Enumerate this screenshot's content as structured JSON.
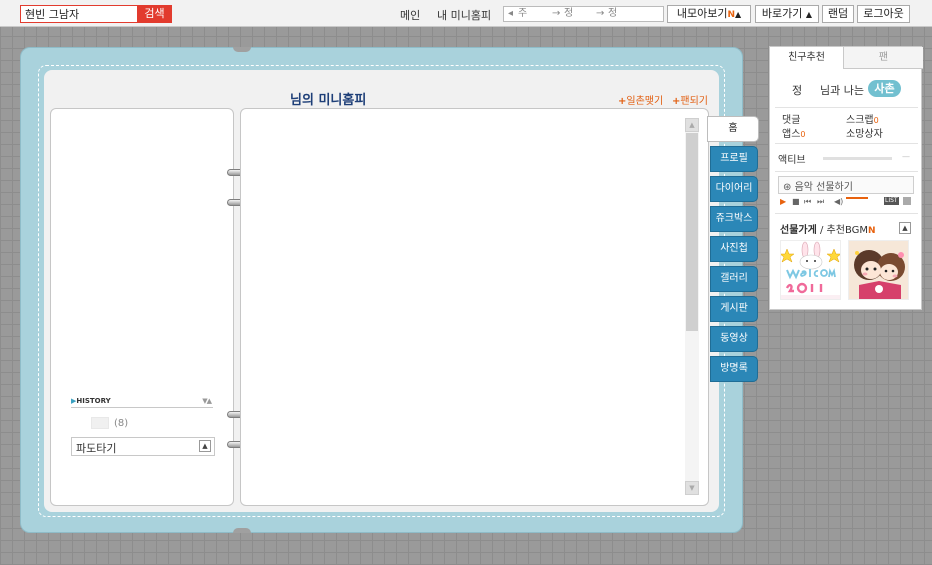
{
  "topbar": {
    "search_value": "현빈 그남자",
    "search_button": "검색",
    "link_main": "메인",
    "link_my_home": "내 미니홈피",
    "nav_select": {
      "seg1": "주",
      "seg2": "정",
      "seg3": "정"
    },
    "my_view": "내모아보기",
    "new_badge": "N",
    "shortcut": "바로가기",
    "random": "랜덤",
    "logout": "로그아웃"
  },
  "home": {
    "title": "님의 미니홈피",
    "link_ilchon": "일촌맺기",
    "link_fan": "팬되기"
  },
  "left": {
    "history_label": "HISTORY",
    "history_count": "(8)",
    "pado_label": "파도타기"
  },
  "tabs": [
    {
      "label": "홈"
    },
    {
      "label": "프로필"
    },
    {
      "label": "다이어리"
    },
    {
      "label": "쥬크박스"
    },
    {
      "label": "사진첩"
    },
    {
      "label": "갤러리"
    },
    {
      "label": "게시판"
    },
    {
      "label": "동영상"
    },
    {
      "label": "방명록"
    }
  ],
  "widget": {
    "tab_friend": "친구추천",
    "tab_fan": "팬",
    "relation_left": "정",
    "relation_mid": "님과 나는",
    "relation_badge": "사촌",
    "stat_comment": "댓글",
    "stat_scrap": "스크랩",
    "stat_scrap_count": "0",
    "stat_apps": "앱스",
    "stat_apps_count": "0",
    "stat_wishbox": "소망상자",
    "active_label": "액티브",
    "active_level": 0,
    "music_gift": "음악 선물하기",
    "list_label": "LIST",
    "gift_shop": "선물가게",
    "recommend_bgm": "추천BGM",
    "gift_items": [
      {
        "icon": "bunny-welcome-2011-image"
      },
      {
        "icon": "cartoon-couple-image"
      }
    ]
  },
  "colors": {
    "search_red": "#e23b2e",
    "binder_blue": "#a9d2dc",
    "tab_blue": "#2b87b7",
    "title_navy": "#1e3f78",
    "accent_orange": "#e25e10",
    "badge_teal": "#72c0d0"
  }
}
